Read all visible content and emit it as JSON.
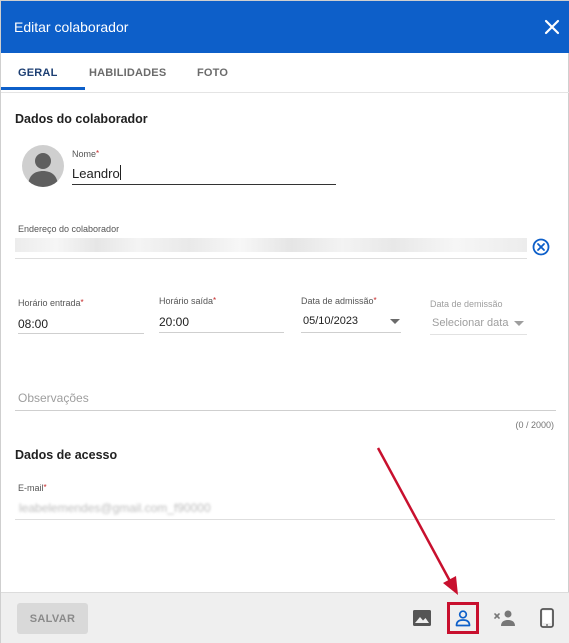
{
  "dialog": {
    "title": "Editar colaborador"
  },
  "tabs": [
    {
      "label": "GERAL",
      "active": true
    },
    {
      "label": "HABILIDADES",
      "active": false
    },
    {
      "label": "FOTO",
      "active": false
    }
  ],
  "collaborator": {
    "section_title": "Dados do colaborador",
    "name_label": "Nome",
    "name_value": "Leandro",
    "address_label": "Endereço do colaborador",
    "entry_time_label": "Horário entrada",
    "entry_time_value": "08:00",
    "exit_time_label": "Horário saída",
    "exit_time_value": "20:00",
    "admission_label": "Data de admissão",
    "admission_value": "05/10/2023",
    "dismissal_label": "Data de demissão",
    "dismissal_placeholder": "Selecionar data",
    "notes_placeholder": "Observações",
    "notes_counter": "(0 / 2000)",
    "required_mark": "*"
  },
  "access": {
    "section_title": "Dados de acesso",
    "email_label": "E-mail",
    "email_value": "leabelemendes@gmail.com_f90000"
  },
  "footer": {
    "save_label": "SALVAR",
    "icons": [
      "image-icon",
      "person-icon",
      "person-remove-icon",
      "smartphone-icon"
    ]
  },
  "colors": {
    "primary": "#0d5fc9",
    "highlight": "#c8102e",
    "tab_active_text": "#1d3f73"
  }
}
